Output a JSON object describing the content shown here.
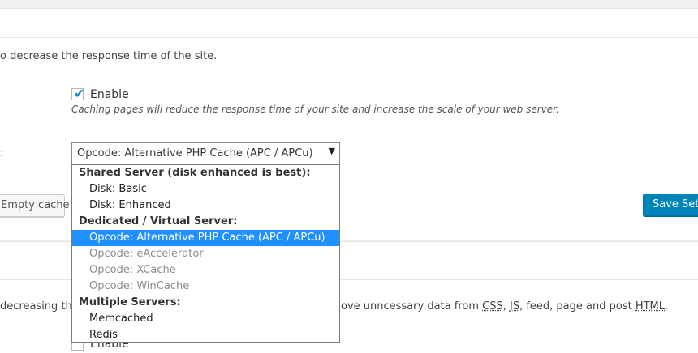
{
  "page_cache": {
    "description": "o decrease the response time of the site.",
    "enable_label": "Enable",
    "enabled": true,
    "hint": "Caching pages will reduce the response time of your site and increase the scale of your web server.",
    "method_label_colon": ":",
    "method_selected": "Opcode: Alternative PHP Cache (APC / APCu)",
    "method_arrow": "▼",
    "options": [
      {
        "type": "group",
        "label": "Shared Server (disk enhanced is best):"
      },
      {
        "type": "option",
        "label": "Disk: Basic",
        "disabled": false,
        "selected": false
      },
      {
        "type": "option",
        "label": "Disk: Enhanced",
        "disabled": false,
        "selected": false
      },
      {
        "type": "group",
        "label": "Dedicated / Virtual Server:"
      },
      {
        "type": "option",
        "label": "Opcode: Alternative PHP Cache (APC / APCu)",
        "disabled": false,
        "selected": true
      },
      {
        "type": "option",
        "label": "Opcode: eAccelerator",
        "disabled": true,
        "selected": false
      },
      {
        "type": "option",
        "label": "Opcode: XCache",
        "disabled": true,
        "selected": false
      },
      {
        "type": "option",
        "label": "Opcode: WinCache",
        "disabled": true,
        "selected": false
      },
      {
        "type": "group",
        "label": "Multiple Servers:"
      },
      {
        "type": "option",
        "label": "Memcached",
        "disabled": false,
        "selected": false
      },
      {
        "type": "option",
        "label": "Redis",
        "disabled": false,
        "selected": false
      }
    ],
    "empty_cache_label": "Empty cache",
    "save_settings_label": "Save Setti"
  },
  "minify": {
    "description_start": "decreasing the s",
    "description_mid": "ove unncessary data from ",
    "css": "CSS",
    "sep1": ", ",
    "js": "JS",
    "description_tail": ", feed, page and post ",
    "html": "HTML",
    "period": ".",
    "enable_label": "Enable",
    "enabled": false
  }
}
